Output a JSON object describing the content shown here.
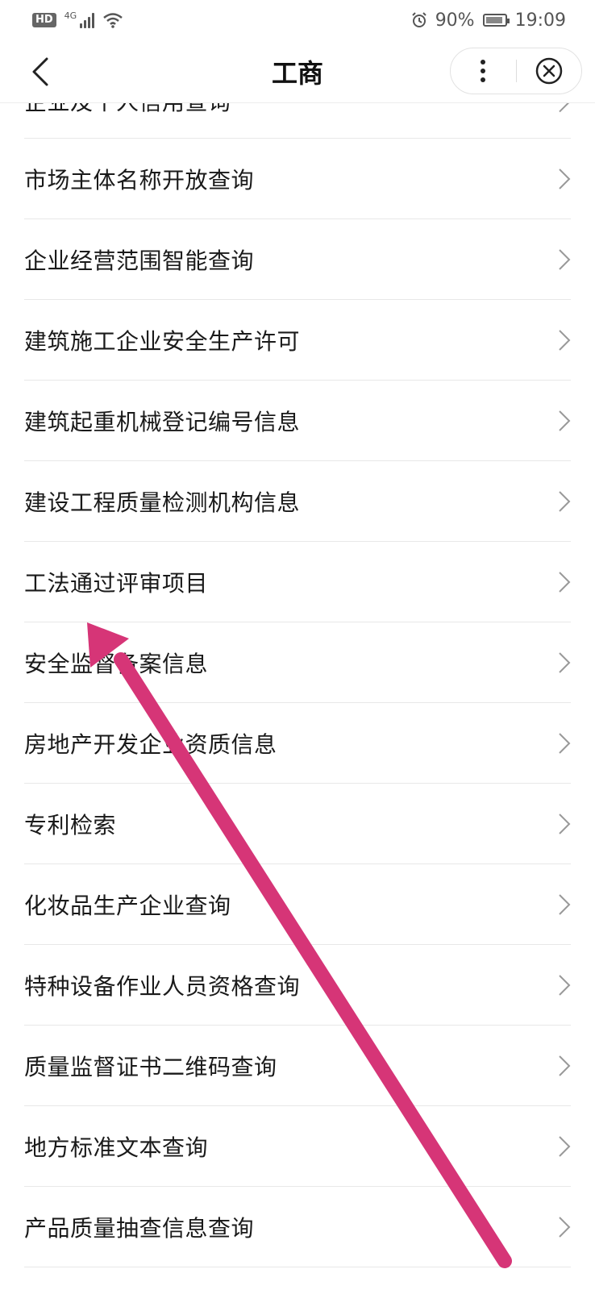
{
  "status_bar": {
    "hd": "HD",
    "network": "4G",
    "battery": "90%",
    "time": "19:09"
  },
  "nav": {
    "title": "工商"
  },
  "partial_item": "企业及个人信用查询",
  "items": [
    {
      "label": "市场主体名称开放查询"
    },
    {
      "label": "企业经营范围智能查询"
    },
    {
      "label": "建筑施工企业安全生产许可"
    },
    {
      "label": "建筑起重机械登记编号信息"
    },
    {
      "label": "建设工程质量检测机构信息"
    },
    {
      "label": "工法通过评审项目"
    },
    {
      "label": "安全监督备案信息"
    },
    {
      "label": "房地产开发企业资质信息"
    },
    {
      "label": "专利检索"
    },
    {
      "label": "化妆品生产企业查询"
    },
    {
      "label": "特种设备作业人员资格查询"
    },
    {
      "label": "质量监督证书二维码查询"
    },
    {
      "label": "地方标准文本查询"
    },
    {
      "label": "产品质量抽查信息查询"
    }
  ],
  "colors": {
    "annotation_arrow": "#d63577"
  }
}
